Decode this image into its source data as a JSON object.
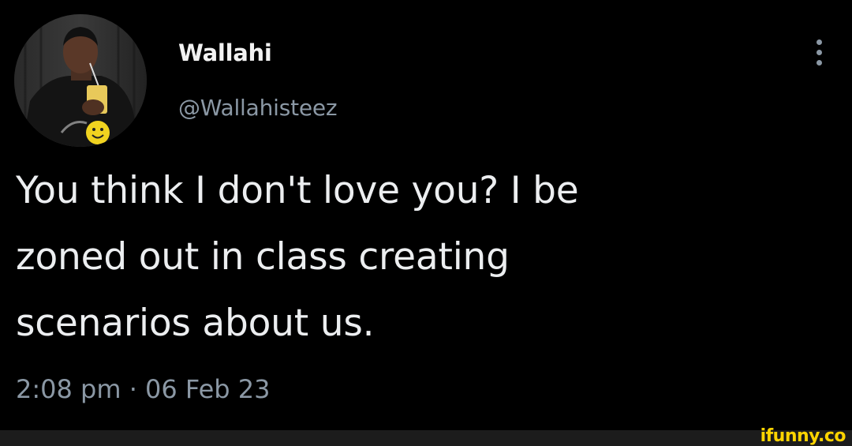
{
  "tweet": {
    "display_name": "Wallahi",
    "handle": "@Wallahisteez",
    "text_lines": [
      "You think I don't love you? I be",
      "zoned out in class creating",
      "scenarios about us."
    ],
    "timestamp": "2:08 pm · 06 Feb 23"
  },
  "icons": {
    "avatar": "avatar",
    "more": "more-options-icon"
  },
  "watermark": {
    "text": "ifunny.co",
    "color": "#ffd400"
  },
  "colors": {
    "background": "#000000",
    "primary_text": "#e7e9ea",
    "secondary_text": "#8b98a5"
  }
}
